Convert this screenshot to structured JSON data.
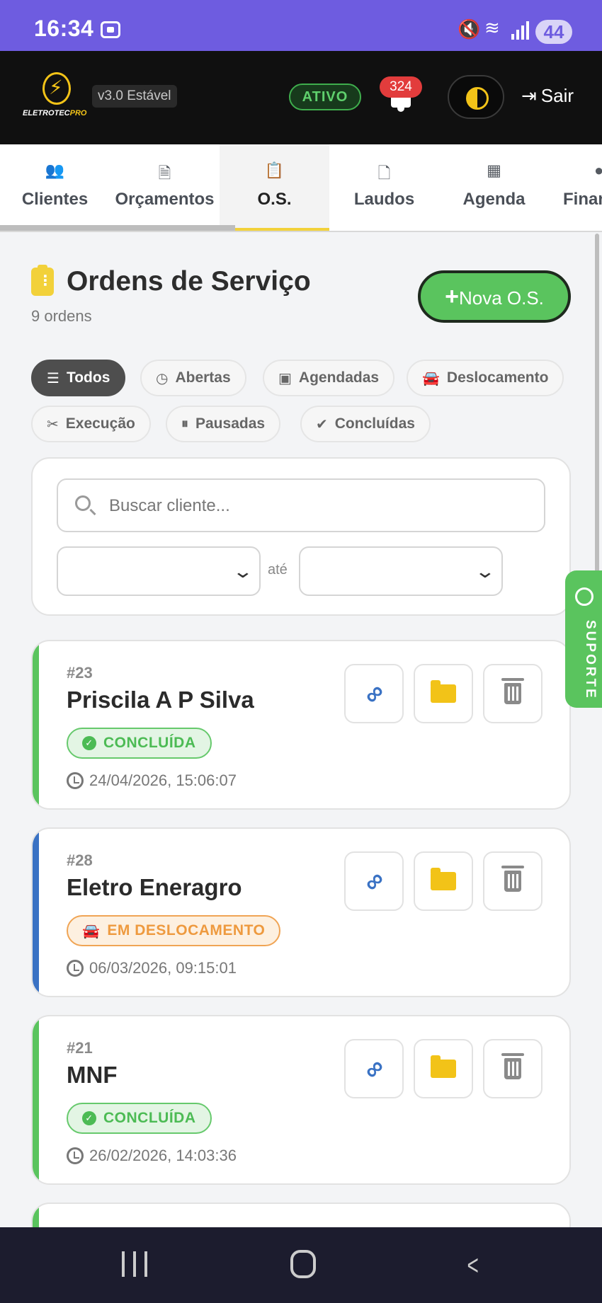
{
  "status_bar": {
    "time": "16:34",
    "battery": "44"
  },
  "header": {
    "logo_text": "ELETROTECPRO",
    "version": "v3.0 Estável",
    "status": "ATIVO",
    "notifications": "324",
    "logout": "Sair"
  },
  "tabs": [
    {
      "label": "Clientes",
      "icon": "users-icon"
    },
    {
      "label": "Orçamentos",
      "icon": "invoice-dollar-icon"
    },
    {
      "label": "O.S.",
      "icon": "clipboard-list-icon",
      "active": true
    },
    {
      "label": "Laudos",
      "icon": "file-pdf-icon"
    },
    {
      "label": "Agenda",
      "icon": "calendar-icon"
    },
    {
      "label": "Finan",
      "icon": "circle-icon"
    }
  ],
  "page": {
    "title": "Ordens de Serviço",
    "count": "9 ordens",
    "new_button": "Nova O.S.",
    "new_button_icon": "+"
  },
  "filters": [
    {
      "label": "Todos",
      "icon": "list-icon",
      "active": true
    },
    {
      "label": "Abertas",
      "icon": "clock-icon"
    },
    {
      "label": "Agendadas",
      "icon": "calendar-check-icon"
    },
    {
      "label": "Deslocamento",
      "icon": "car-icon"
    },
    {
      "label": "Execução",
      "icon": "tools-icon"
    },
    {
      "label": "Pausadas",
      "icon": "pause-circle-icon"
    },
    {
      "label": "Concluídas",
      "icon": "check-circle-icon"
    }
  ],
  "search": {
    "placeholder": "Buscar cliente...",
    "date_from": "",
    "date_to": "",
    "between_label": "até"
  },
  "orders": [
    {
      "number": "#23",
      "client": "Priscila A P Silva",
      "status": "CONCLUÍDA",
      "status_kind": "done",
      "datetime": "24/04/2026, 15:06:07",
      "stripe_color": "#5ac45e"
    },
    {
      "number": "#28",
      "client": "Eletro Eneragro",
      "status": "EM DESLOCAMENTO",
      "status_kind": "travel",
      "datetime": "06/03/2026, 09:15:01",
      "stripe_color": "#3a72c4"
    },
    {
      "number": "#21",
      "client": "MNF",
      "status": "CONCLUÍDA",
      "status_kind": "done",
      "datetime": "26/02/2026, 14:03:36",
      "stripe_color": "#5ac45e"
    }
  ],
  "support": "SUPORTE",
  "colors": {
    "accent": "#6e5ce0",
    "success": "#5ac45e",
    "warning": "#ee9a3f",
    "primary_blue": "#3a72c4",
    "yellow": "#f2c318"
  }
}
